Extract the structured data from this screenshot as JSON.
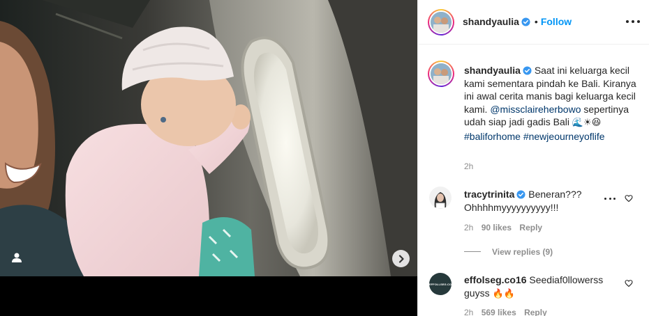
{
  "post": {
    "author": {
      "username": "shandyaulia",
      "verified": true
    },
    "follow_label": "Follow",
    "header_separator": "•",
    "caption": {
      "text_1": "Saat ini keluarga kecil kami sementara pindah ke Bali. Kiranya ini awal cerita manis bagi keluarga kecil kami.",
      "mention": "@missclaireherbowo",
      "text_2": " sepertinya udah siap jadi gadis Bali ",
      "emojis": [
        "🌊",
        "☀",
        "😆"
      ],
      "hashtags": [
        "#baliforhome",
        "#newjeourneyoflife"
      ]
    },
    "time_ago": "2h"
  },
  "comments": [
    {
      "username": "tracytrinita",
      "verified": true,
      "text_line_1": "Beneran???",
      "text_line_2": "Ohhhhmyyyyyyyyyy!!!",
      "time": "2h",
      "likes": "90 likes",
      "reply_label": "Reply",
      "view_replies": "View replies (9)"
    },
    {
      "username": "effolseg.co16",
      "avatar_text": "EFFOLLSEG.CO",
      "verified": false,
      "text": "Seediaf0llowerss guyss",
      "emojis": [
        "🔥",
        "🔥"
      ],
      "time": "2h",
      "likes": "569 likes",
      "reply_label": "Reply"
    }
  ],
  "icons": {
    "tag_people": "person-icon",
    "next_slide": "chevron-right-icon",
    "more_options": "more-horizontal-icon",
    "like": "heart-icon",
    "verified": "verified-badge-icon"
  },
  "colors": {
    "link_blue": "#0095f6",
    "tag_navy": "#00376b",
    "muted_gray": "#8e8e8e",
    "verified_blue": "#3897f0"
  }
}
